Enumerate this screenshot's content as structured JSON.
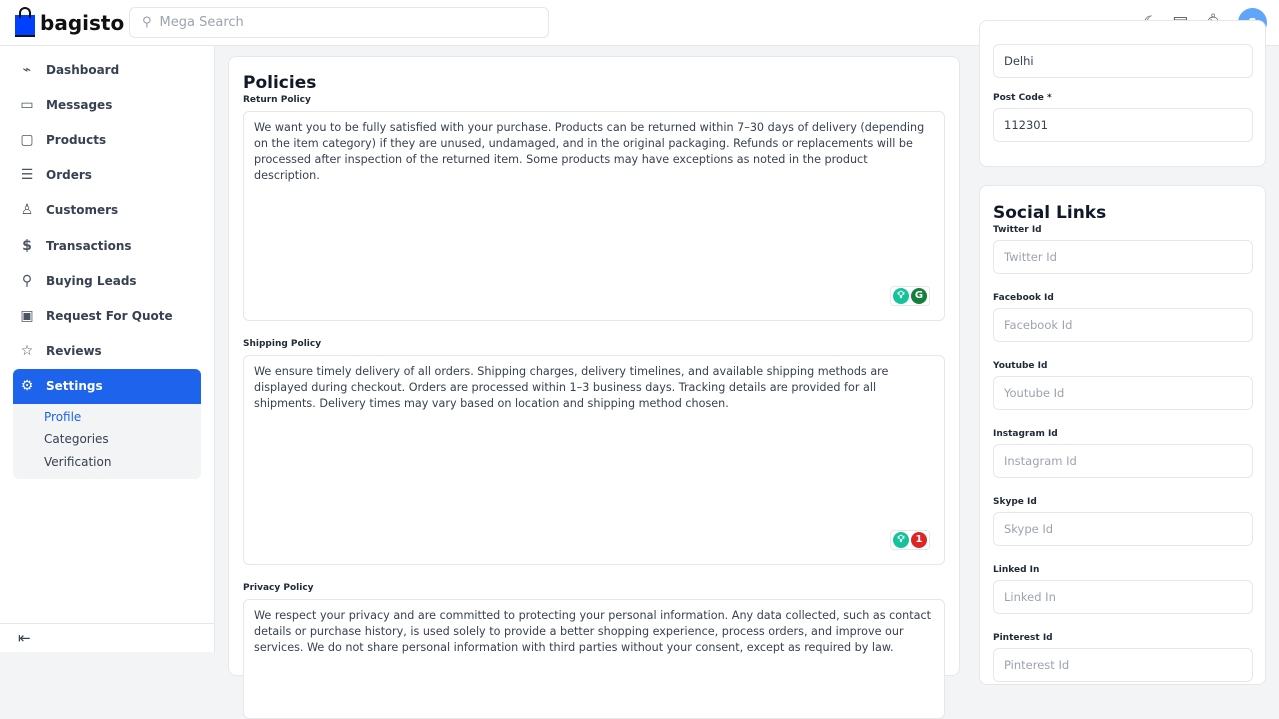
{
  "header": {
    "brand": "bagisto",
    "search_placeholder": "Mega Search",
    "avatar_initial": "S",
    "icons": [
      "moon-icon",
      "store-icon",
      "bell-icon"
    ]
  },
  "sidebar": {
    "items": [
      {
        "label": "Dashboard",
        "icon": "dashboard-icon"
      },
      {
        "label": "Messages",
        "icon": "message-icon"
      },
      {
        "label": "Products",
        "icon": "product-icon"
      },
      {
        "label": "Orders",
        "icon": "orders-icon"
      },
      {
        "label": "Customers",
        "icon": "user-icon"
      },
      {
        "label": "Transactions",
        "icon": "transactions-icon"
      },
      {
        "label": "Buying Leads",
        "icon": "leads-icon"
      },
      {
        "label": "Request For Quote",
        "icon": "quote-icon"
      },
      {
        "label": "Reviews",
        "icon": "star-icon"
      },
      {
        "label": "Settings",
        "icon": "gear-icon",
        "active": true
      }
    ],
    "sub_items": [
      "Profile",
      "Categories",
      "Verification"
    ],
    "active_sub": "Profile"
  },
  "policies": {
    "title": "Policies",
    "return_label": "Return Policy",
    "return_text": "We want you to be fully satisfied with your purchase. Products can be returned within 7–30 days of delivery (depending on the item category) if they are unused, undamaged, and in the original packaging. Refunds or replacements will be processed after inspection of the returned item. Some products may have exceptions as noted in the product description.",
    "shipping_label": "Shipping Policy",
    "shipping_text": "We ensure timely delivery of all orders. Shipping charges, delivery timelines, and available shipping methods are displayed during checkout. Orders are processed within 1–3 business days. Tracking details are provided for all shipments. Delivery times may vary based on location and shipping method chosen.",
    "shipping_issue_count": "1",
    "privacy_label": "Privacy Policy",
    "privacy_text": "We respect your privacy and are committed to protecting your personal information. Any data collected, such as contact details or purchase history, is used solely to provide a better shopping experience, process orders, and improve our services. We do not share personal information with third parties without your consent, except as required by law."
  },
  "address": {
    "city_value": "Delhi",
    "postcode_label": "Post Code *",
    "postcode_value": "112301"
  },
  "social": {
    "title": "Social Links",
    "fields": [
      {
        "label": "Twitter Id",
        "placeholder": "Twitter Id"
      },
      {
        "label": "Facebook Id",
        "placeholder": "Facebook Id"
      },
      {
        "label": "Youtube Id",
        "placeholder": "Youtube Id"
      },
      {
        "label": "Instagram Id",
        "placeholder": "Instagram Id"
      },
      {
        "label": "Skype Id",
        "placeholder": "Skype Id"
      },
      {
        "label": "Linked In",
        "placeholder": "Linked In"
      },
      {
        "label": "Pinterest Id",
        "placeholder": "Pinterest Id"
      }
    ]
  }
}
